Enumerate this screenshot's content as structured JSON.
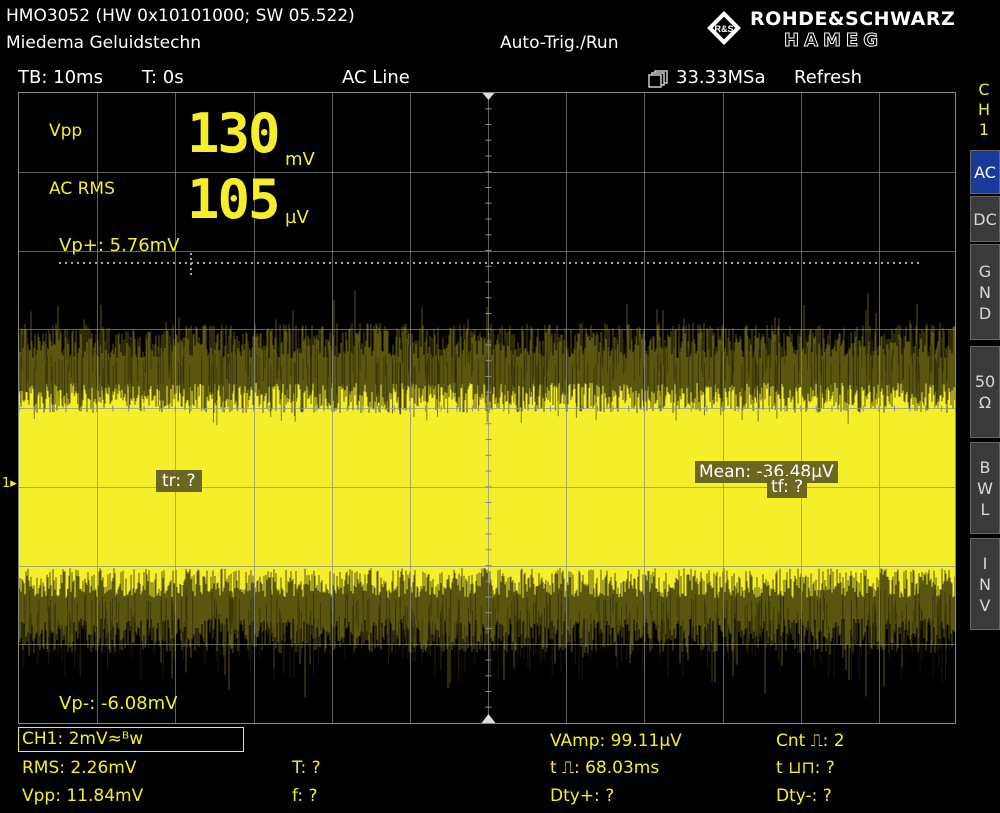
{
  "header": {
    "device": "HMO3052 (HW 0x10101000; SW 05.522)",
    "user": "Miedema Geluidstechn",
    "trigger_mode": "Auto-Trig./Run",
    "brand_line1": "ROHDE&SCHWARZ",
    "brand_line2": "HAMEG",
    "logo_icon": "rs-diamond-logo"
  },
  "status": {
    "timebase": "TB: 10ms",
    "trigger_time": "T: 0s",
    "trigger_source": "AC Line",
    "acq_icon": "memory-stack-icon",
    "sample_rate": "33.33MSa",
    "acq_mode": "Refresh"
  },
  "measurements_big": [
    {
      "label": "Vpp",
      "value": "130",
      "unit": "mV"
    },
    {
      "label": "AC RMS",
      "value": "105",
      "unit": "µV"
    }
  ],
  "cursors": {
    "vp_plus": "Vp+: 5.76mV",
    "vp_minus": "Vp-: -6.08mV",
    "tr_left": "tr: ?",
    "mean": "Mean: -36.48µV",
    "tf": "tf: ?",
    "ch_marker": "1"
  },
  "softkeys": {
    "channel": [
      "C",
      "H",
      "1"
    ],
    "items": [
      {
        "label": [
          "AC"
        ],
        "active": true
      },
      {
        "label": [
          "DC"
        ],
        "active": false
      },
      {
        "label": [
          "G",
          "N",
          "D"
        ],
        "active": false
      },
      {
        "label": [
          "50",
          "Ω"
        ],
        "active": false
      },
      {
        "label": [
          "B",
          "W",
          "L"
        ],
        "active": false
      },
      {
        "label": [
          "I",
          "N",
          "V"
        ],
        "active": false
      }
    ]
  },
  "bottom": {
    "channel_setting": "CH1: 2mV≈ᴮw",
    "rms": "RMS: 2.26mV",
    "vpp": "Vpp: 11.84mV",
    "t": "T: ?",
    "f": "f: ?",
    "vamp": "VAmp: 99.11µV",
    "t_pos_pulse": "t ⎍: 68.03ms",
    "dty_plus": "Dty+: ?",
    "cnt": "Cnt ⎍: 2",
    "t_neg_pulse": "t ⊔⊓: ?",
    "dty_minus": "Dty-: ?"
  },
  "colors": {
    "trace": "#f4ef2a",
    "background": "#000000",
    "grid": "#8a8a8a",
    "active_softkey": "#1a3a9a"
  }
}
